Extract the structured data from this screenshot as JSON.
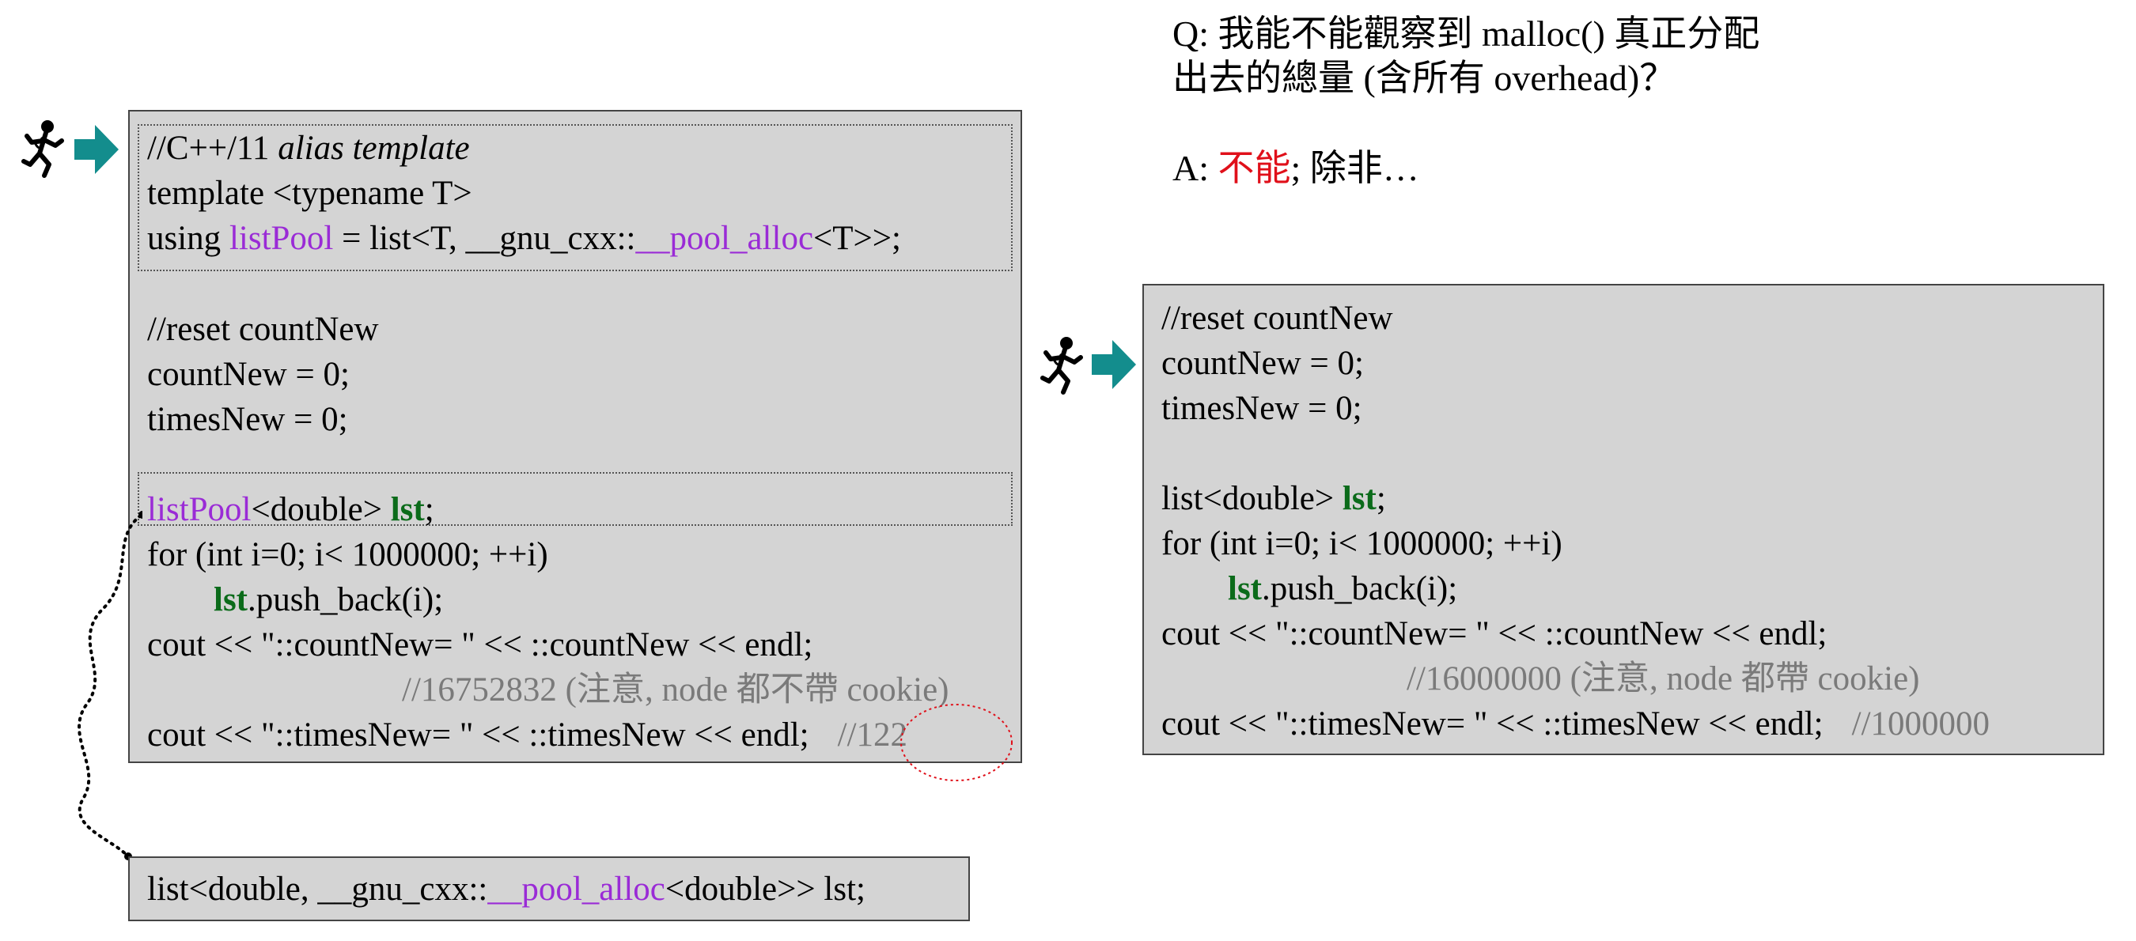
{
  "left_code": {
    "lines": [
      [
        "//C++/11 ",
        "alias template"
      ],
      "template <typename T>",
      [
        "using ",
        "listPool",
        " = list<T, __gnu_cxx::",
        "__pool_alloc",
        "<T>>;"
      ],
      "//reset countNew",
      "countNew = 0;",
      "timesNew = 0;",
      [
        "listPool",
        "<double> ",
        "lst",
        ";"
      ],
      "for (int i=0; i< 1000000; ++i)",
      [
        "lst",
        ".push_back(i);"
      ],
      "cout << \"::countNew= \" << ::countNew << endl;",
      "//16752832 (注意, node 都不帶 cookie)",
      [
        "cout << \"::timesNew= \" << ::timesNew << endl;",
        "//122"
      ]
    ]
  },
  "bottom_code": {
    "parts": [
      "list<double, __gnu_cxx::",
      "__pool_alloc",
      "<double>> lst;"
    ]
  },
  "right_code": {
    "lines": [
      "//reset countNew",
      "countNew = 0;",
      "timesNew = 0;",
      [
        "list<double> ",
        "lst",
        ";"
      ],
      "for (int i=0; i< 1000000; ++i)",
      [
        "lst",
        ".push_back(i);"
      ],
      "cout << \"::countNew= \" << ::countNew << endl;",
      "//16000000 (注意, node 都帶 cookie)",
      [
        "cout << \"::timesNew= \" << ::timesNew << endl;",
        "//1000000"
      ]
    ]
  },
  "qa": {
    "q_line1": "Q: 我能不能觀察到 malloc() 真正分配",
    "q_line2": "出去的總量 (含所有 overhead)？",
    "a_prefix": "A: ",
    "a_highlight": "不能",
    "a_suffix": "; 除非…"
  },
  "icons": [
    "running-man-icon",
    "teal-arrow-icon"
  ],
  "colors": {
    "purple": "#9a2bd6",
    "green": "#0b6b1a",
    "red": "#e0101a",
    "gray": "#7a7a7a",
    "teal": "#138d8d",
    "box": "#d4d4d4"
  }
}
